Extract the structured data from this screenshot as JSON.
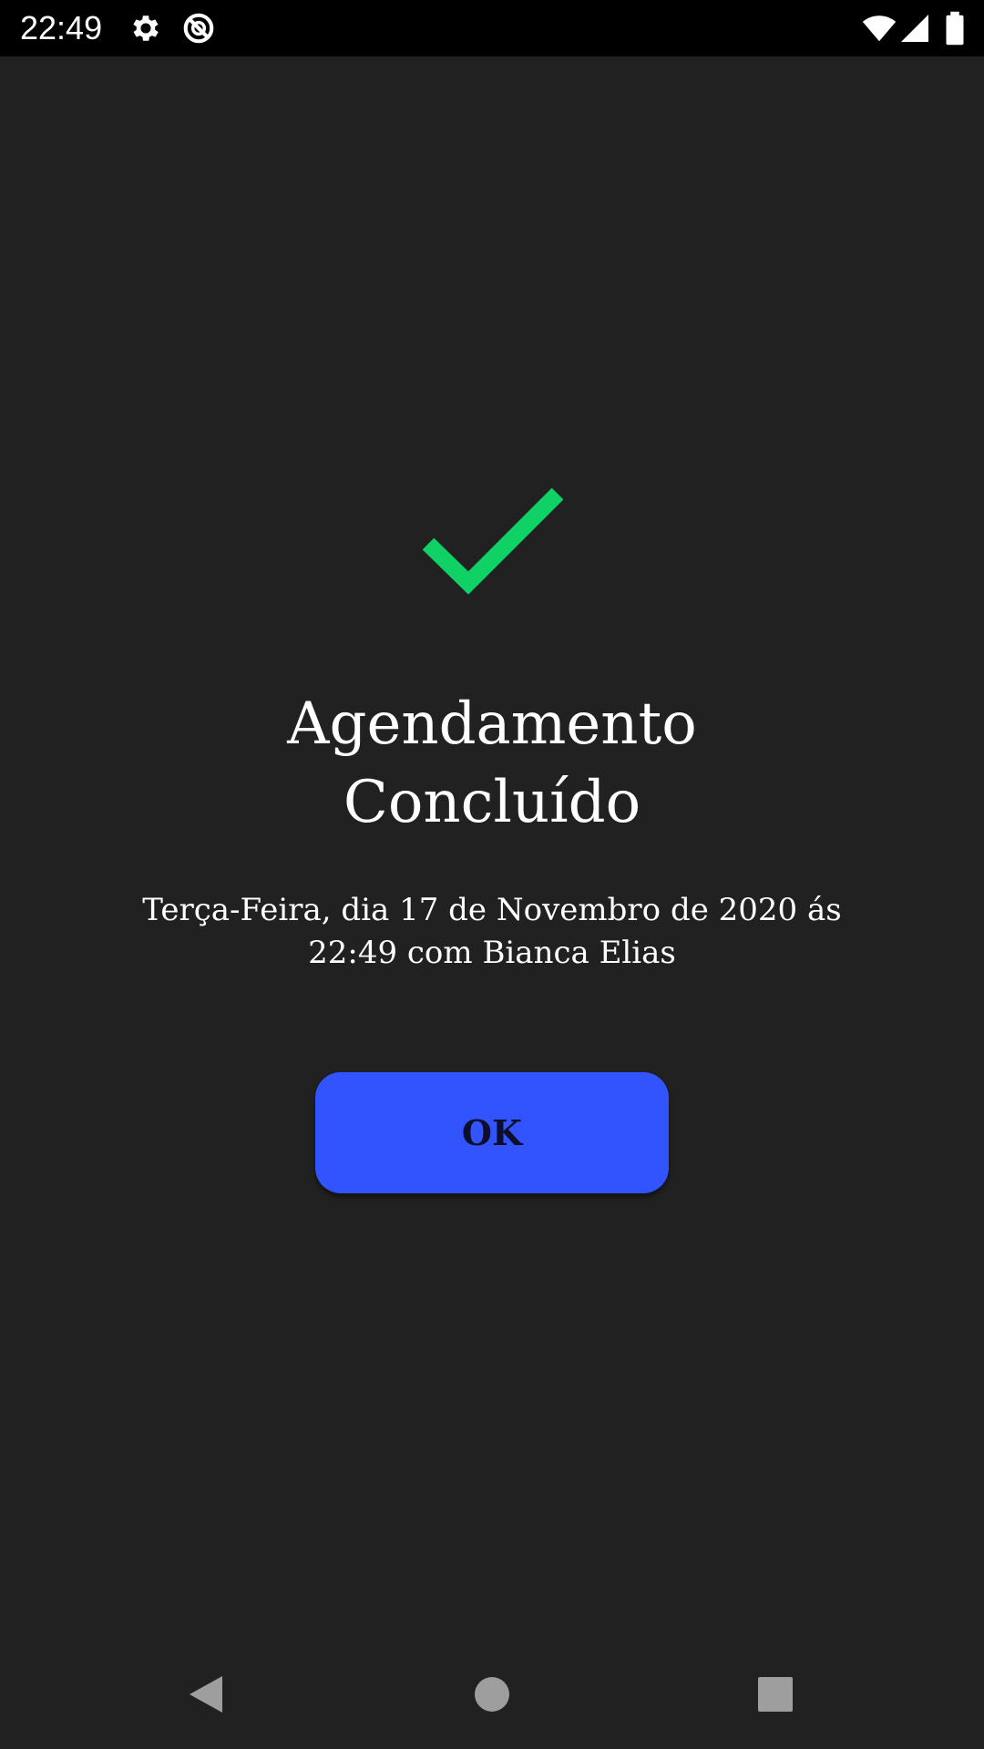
{
  "status_bar": {
    "time": "22:49",
    "icons": [
      "gear-icon",
      "no-sync-icon",
      "wifi-icon",
      "signal-icon",
      "battery-icon"
    ]
  },
  "confirmation": {
    "icon": "checkmark-icon",
    "icon_color": "#0fd166",
    "title_line1": "Agendamento",
    "title_line2": "Concluído",
    "details_line1": "Terça-Feira, dia 17 de Novembro de 2020 ás",
    "details_line2": "22:49 com Bianca Elias",
    "ok_label": "OK",
    "ok_color": "#3154ff"
  },
  "nav_bar": {
    "buttons": [
      "back-icon",
      "home-icon",
      "recents-icon"
    ]
  }
}
